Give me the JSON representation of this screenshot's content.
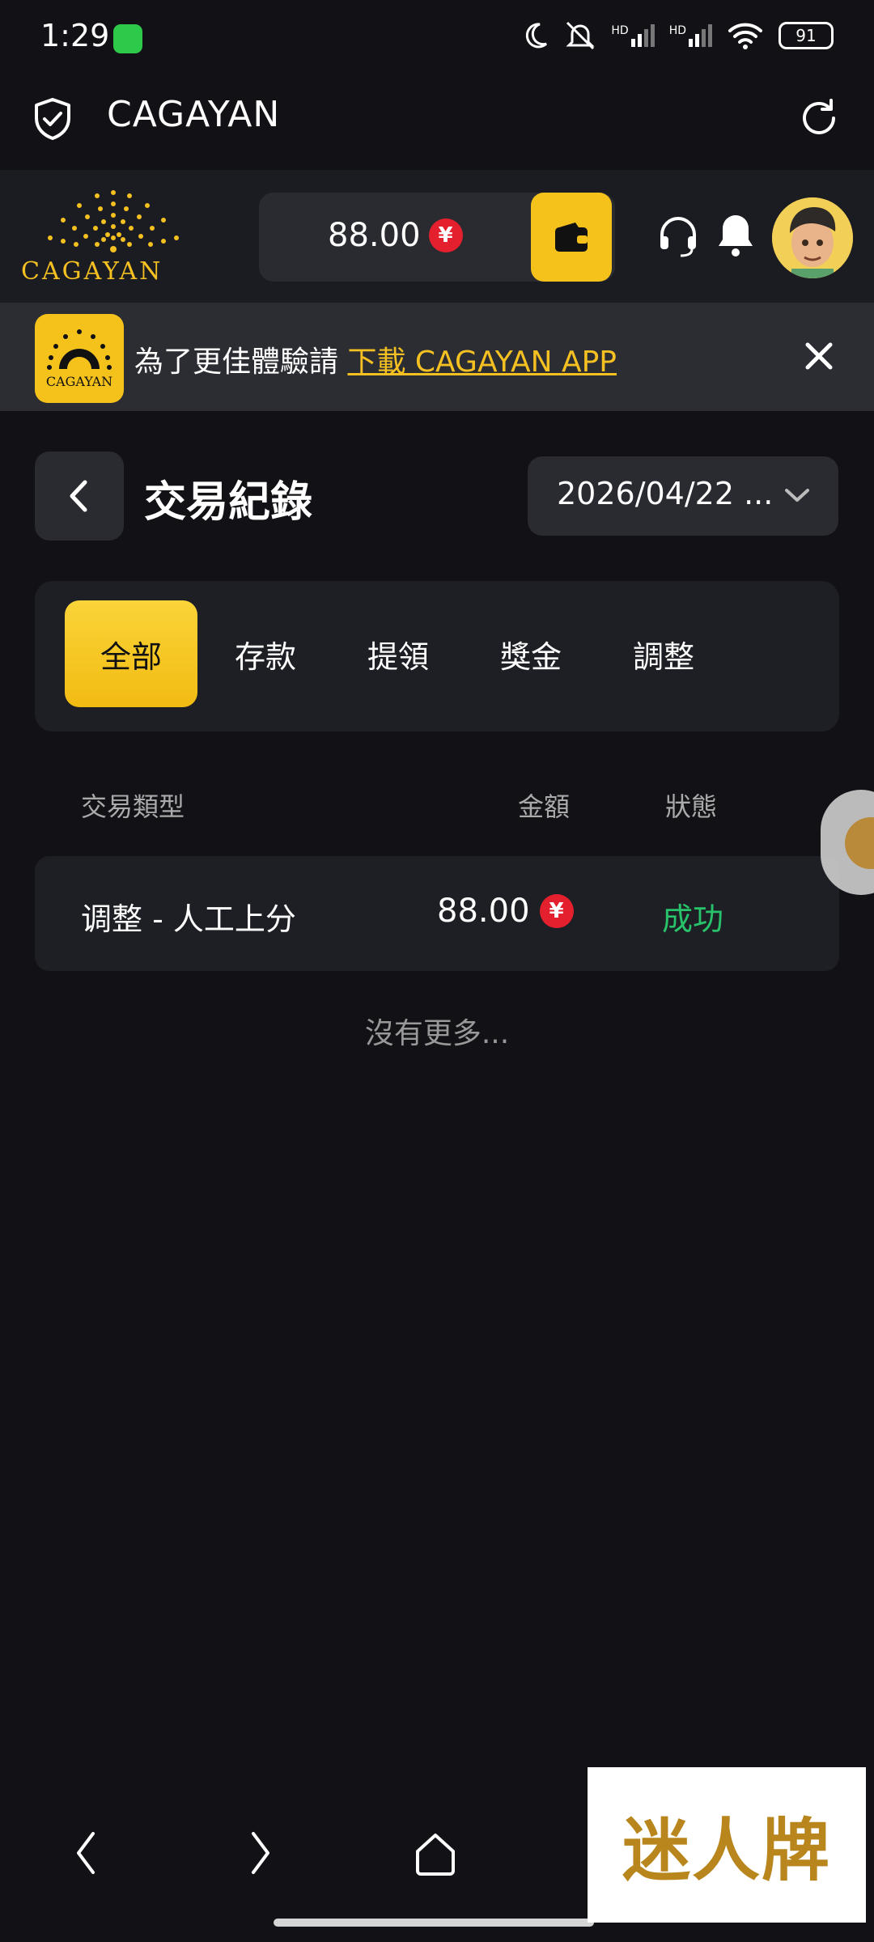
{
  "status_bar": {
    "time": "1:29",
    "battery": "91",
    "net1": "HD",
    "net2": "HD"
  },
  "app_bar": {
    "title": "CAGAYAN"
  },
  "header": {
    "logo_text": "CAGAYAN",
    "balance": "88.00",
    "currency_symbol": "¥"
  },
  "banner": {
    "prefix": "為了更佳體驗請",
    "link": "下載 CAGAYAN APP",
    "logo_text": "CAGAYAN"
  },
  "page": {
    "title": "交易紀錄",
    "date_value": "2026/04/22 ..."
  },
  "tabs": [
    {
      "label": "全部",
      "active": true
    },
    {
      "label": "存款",
      "active": false
    },
    {
      "label": "提領",
      "active": false
    },
    {
      "label": "獎金",
      "active": false
    },
    {
      "label": "調整",
      "active": false
    }
  ],
  "table": {
    "headers": {
      "type": "交易類型",
      "amount": "金額",
      "status": "狀態"
    },
    "rows": [
      {
        "type": "调整 - 人工上分",
        "amount": "88.00",
        "currency_symbol": "¥",
        "status": "成功"
      }
    ],
    "no_more": "沒有更多..."
  },
  "watermark": {
    "text": "迷人牌"
  },
  "colors": {
    "accent": "#f5c21b",
    "success": "#27c26a",
    "background": "#111116",
    "panel": "#1e1f25",
    "currency": "#e5202e"
  },
  "icons": [
    "shield-check-icon",
    "refresh-icon",
    "wallet-icon",
    "headset-icon",
    "bell-icon",
    "close-icon",
    "chevron-left-icon",
    "chevron-down-icon",
    "wechat-icon",
    "moon-icon",
    "mute-icon",
    "wifi-icon",
    "signal-icon",
    "battery-icon"
  ]
}
